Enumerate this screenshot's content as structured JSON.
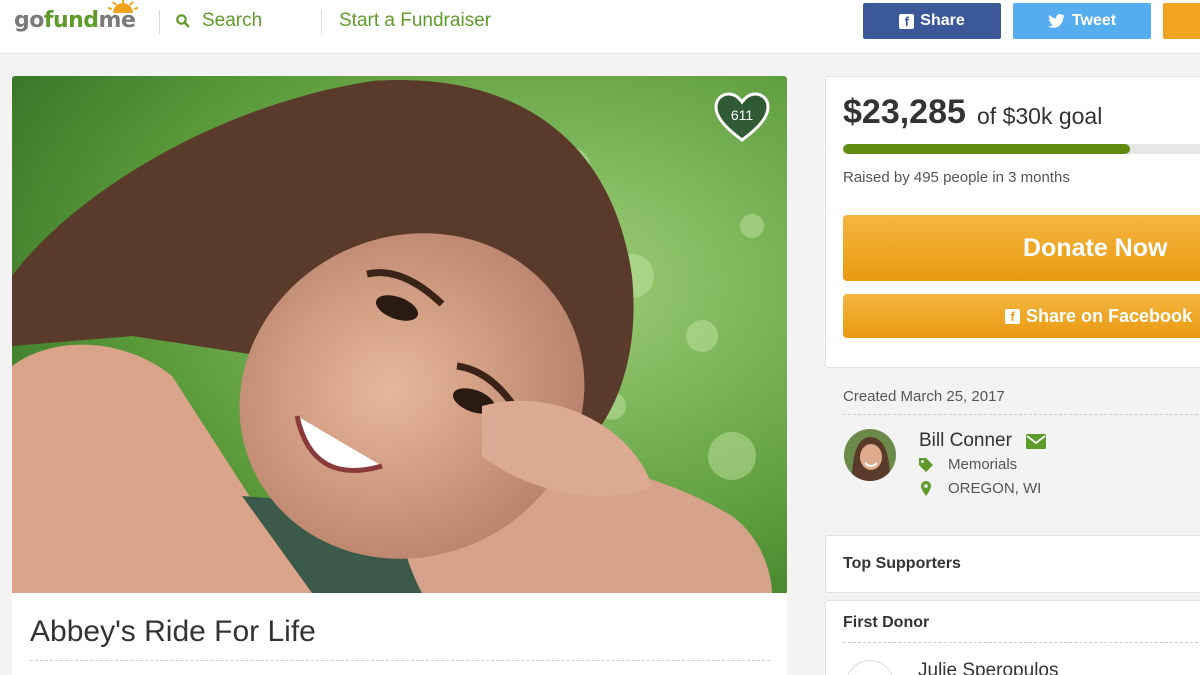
{
  "header": {
    "logo": {
      "go": "go",
      "fund": "fund",
      "me": "me"
    },
    "search_label": "Search",
    "start_label": "Start a Fundraiser",
    "share_label": "Share",
    "tweet_label": "Tweet"
  },
  "campaign": {
    "heart_count": "611",
    "title": "Abbey's Ride For Life"
  },
  "donation": {
    "amount": "$23,285",
    "goal_text": "of $30k goal",
    "progress_fraction": 0.776,
    "raised_text": "Raised by 495 people in 3 months",
    "donate_label": "Donate Now",
    "share_fb_label": "Share on Facebook"
  },
  "organizer": {
    "created": "Created March 25, 2017",
    "name": "Bill Conner",
    "category": "Memorials",
    "location": "OREGON, WI"
  },
  "supporters": {
    "top_label": "Top Supporters",
    "first_donor_label": "First Donor",
    "first_donor_name": "Julie Speropulos"
  },
  "colors": {
    "brand_green": "#5f9b2a",
    "facebook": "#3b5998",
    "twitter": "#55acee",
    "donate_orange": "#f0a41f",
    "progress_green": "#5f8c0e"
  },
  "icons": [
    "search-icon",
    "facebook-icon",
    "twitter-icon",
    "heart-icon",
    "mail-icon",
    "tag-icon",
    "location-pin-icon"
  ]
}
